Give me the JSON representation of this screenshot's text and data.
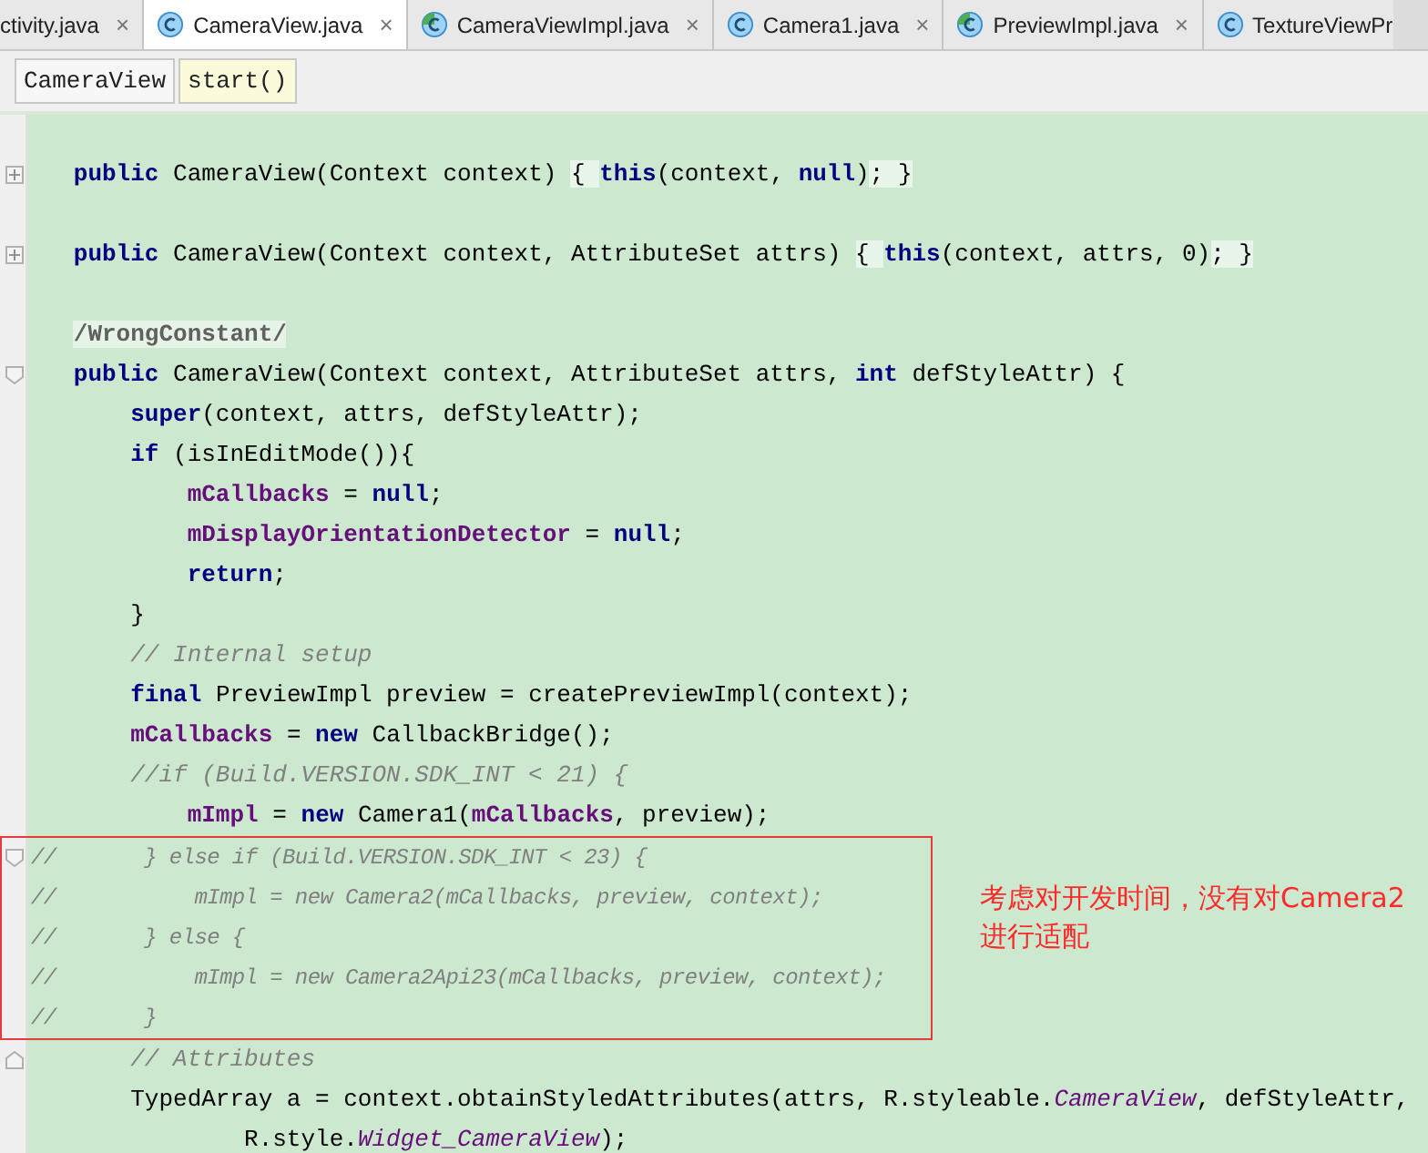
{
  "tabs": [
    {
      "label": "ctivity.java",
      "kind": "cut",
      "close": "×",
      "selected": false
    },
    {
      "label": "CameraView.java",
      "kind": "class",
      "close": "×",
      "selected": true
    },
    {
      "label": "CameraViewImpl.java",
      "kind": "abstract",
      "close": "×",
      "selected": false
    },
    {
      "label": "Camera1.java",
      "kind": "class",
      "close": "×",
      "selected": false
    },
    {
      "label": "PreviewImpl.java",
      "kind": "abstract",
      "close": "×",
      "selected": false
    },
    {
      "label": "TextureViewPr",
      "kind": "class",
      "selected": false
    }
  ],
  "breadcrumbs": [
    {
      "label": "CameraView",
      "selected": false
    },
    {
      "label": "start()",
      "selected": true
    }
  ],
  "code_blocks": [
    {
      "kind": "plain",
      "lines": [
        {
          "kind": "blank"
        },
        {
          "kind": "collapsed",
          "tokens": [
            {
              "kind": "kw",
              "t": "   public"
            },
            {
              "kind": "p",
              "t": " CameraView(Context context)"
            },
            {
              "kind": "hl",
              "t": " { "
            },
            {
              "kind": "kw",
              "t": "this"
            },
            {
              "kind": "p",
              "t": "(context, "
            },
            {
              "kind": "kw",
              "t": "null"
            },
            {
              "kind": "p",
              "t": ")"
            },
            {
              "kind": "hl",
              "t": "; }"
            }
          ]
        },
        {
          "kind": "blank"
        },
        {
          "kind": "collapsed",
          "tokens": [
            {
              "kind": "kw",
              "t": "   public"
            },
            {
              "kind": "p",
              "t": " CameraView(Context context, AttributeSet attrs)"
            },
            {
              "kind": "hl",
              "t": " { "
            },
            {
              "kind": "kw",
              "t": "this"
            },
            {
              "kind": "p",
              "t": "(context, attrs, 0)"
            },
            {
              "kind": "hl",
              "t": "; }"
            }
          ]
        },
        {
          "kind": "blank"
        },
        {
          "kind": "line",
          "tokens": [
            {
              "kind": "ann",
              "t": "   /WrongConstant/"
            }
          ]
        },
        {
          "kind": "fold_start",
          "tokens": [
            {
              "kind": "kw",
              "t": "   public"
            },
            {
              "kind": "p",
              "t": " CameraView(Context context, AttributeSet attrs, "
            },
            {
              "kind": "kw",
              "t": "int"
            },
            {
              "kind": "p",
              "t": " defStyleAttr) {"
            }
          ]
        },
        {
          "kind": "line",
          "tokens": [
            {
              "kind": "kw",
              "t": "       super"
            },
            {
              "kind": "p",
              "t": "(context, attrs, defStyleAttr);"
            }
          ]
        },
        {
          "kind": "line",
          "tokens": [
            {
              "kind": "kw",
              "t": "       if"
            },
            {
              "kind": "p",
              "t": " (isInEditMode()){"
            }
          ]
        },
        {
          "kind": "line",
          "tokens": [
            {
              "kind": "field",
              "t": "           mCallbacks"
            },
            {
              "kind": "p",
              "t": " = "
            },
            {
              "kind": "kw",
              "t": "null"
            },
            {
              "kind": "p",
              "t": ";"
            }
          ]
        },
        {
          "kind": "line",
          "tokens": [
            {
              "kind": "field",
              "t": "           mDisplayOrientationDetector"
            },
            {
              "kind": "p",
              "t": " = "
            },
            {
              "kind": "kw",
              "t": "null"
            },
            {
              "kind": "p",
              "t": ";"
            }
          ]
        },
        {
          "kind": "line",
          "tokens": [
            {
              "kind": "kw",
              "t": "           return"
            },
            {
              "kind": "p",
              "t": ";"
            }
          ]
        },
        {
          "kind": "line",
          "tokens": [
            {
              "kind": "p",
              "t": "       }"
            }
          ]
        },
        {
          "kind": "line",
          "tokens": [
            {
              "kind": "comment",
              "t": "       // Internal setup"
            }
          ]
        },
        {
          "kind": "line",
          "tokens": [
            {
              "kind": "kw",
              "t": "       final"
            },
            {
              "kind": "p",
              "t": " PreviewImpl preview = createPreviewImpl(context);"
            }
          ]
        },
        {
          "kind": "line",
          "tokens": [
            {
              "kind": "field",
              "t": "       mCallbacks"
            },
            {
              "kind": "p",
              "t": " = "
            },
            {
              "kind": "kw",
              "t": "new"
            },
            {
              "kind": "p",
              "t": " CallbackBridge();"
            }
          ]
        },
        {
          "kind": "line",
          "tokens": [
            {
              "kind": "comment",
              "t": "       //if (Build.VERSION.SDK_INT < 21) {"
            }
          ]
        },
        {
          "kind": "line",
          "tokens": [
            {
              "kind": "field",
              "t": "           mImpl"
            },
            {
              "kind": "p",
              "t": " = "
            },
            {
              "kind": "kw",
              "t": "new"
            },
            {
              "kind": "p",
              "t": " Camera1("
            },
            {
              "kind": "field",
              "t": "mCallbacks"
            },
            {
              "kind": "p",
              "t": ", preview);"
            }
          ]
        }
      ]
    },
    {
      "kind": "annotated",
      "note": "考虑对开发时间，没有对Camera2进行适配",
      "lines": [
        {
          "kind": "fold_start",
          "tokens": [
            {
              "kind": "comment",
              "t": "//       } else if (Build.VERSION.SDK_INT < 23) {"
            }
          ]
        },
        {
          "kind": "line",
          "tokens": [
            {
              "kind": "comment",
              "t": "//           mImpl = new Camera2(mCallbacks, preview, context);"
            }
          ]
        },
        {
          "kind": "line",
          "tokens": [
            {
              "kind": "comment",
              "t": "//       } else {"
            }
          ]
        },
        {
          "kind": "line",
          "tokens": [
            {
              "kind": "comment",
              "t": "//           mImpl = new Camera2Api23(mCallbacks, preview, context);"
            }
          ]
        },
        {
          "kind": "line",
          "tokens": [
            {
              "kind": "comment",
              "t": "//       }"
            }
          ]
        }
      ]
    },
    {
      "kind": "plain",
      "lines": [
        {
          "kind": "fold_end",
          "tokens": [
            {
              "kind": "comment",
              "t": "       // Attributes"
            }
          ]
        },
        {
          "kind": "line",
          "tokens": [
            {
              "kind": "p",
              "t": "       TypedArray a = context.obtainStyledAttributes(attrs, R.styleable."
            },
            {
              "kind": "static",
              "t": "CameraView"
            },
            {
              "kind": "p",
              "t": ", defStyleAttr,"
            }
          ]
        },
        {
          "kind": "line",
          "tokens": [
            {
              "kind": "p",
              "t": "               R.style."
            },
            {
              "kind": "static",
              "t": "Widget_CameraView"
            },
            {
              "kind": "p",
              "t": ");"
            }
          ]
        }
      ]
    }
  ]
}
